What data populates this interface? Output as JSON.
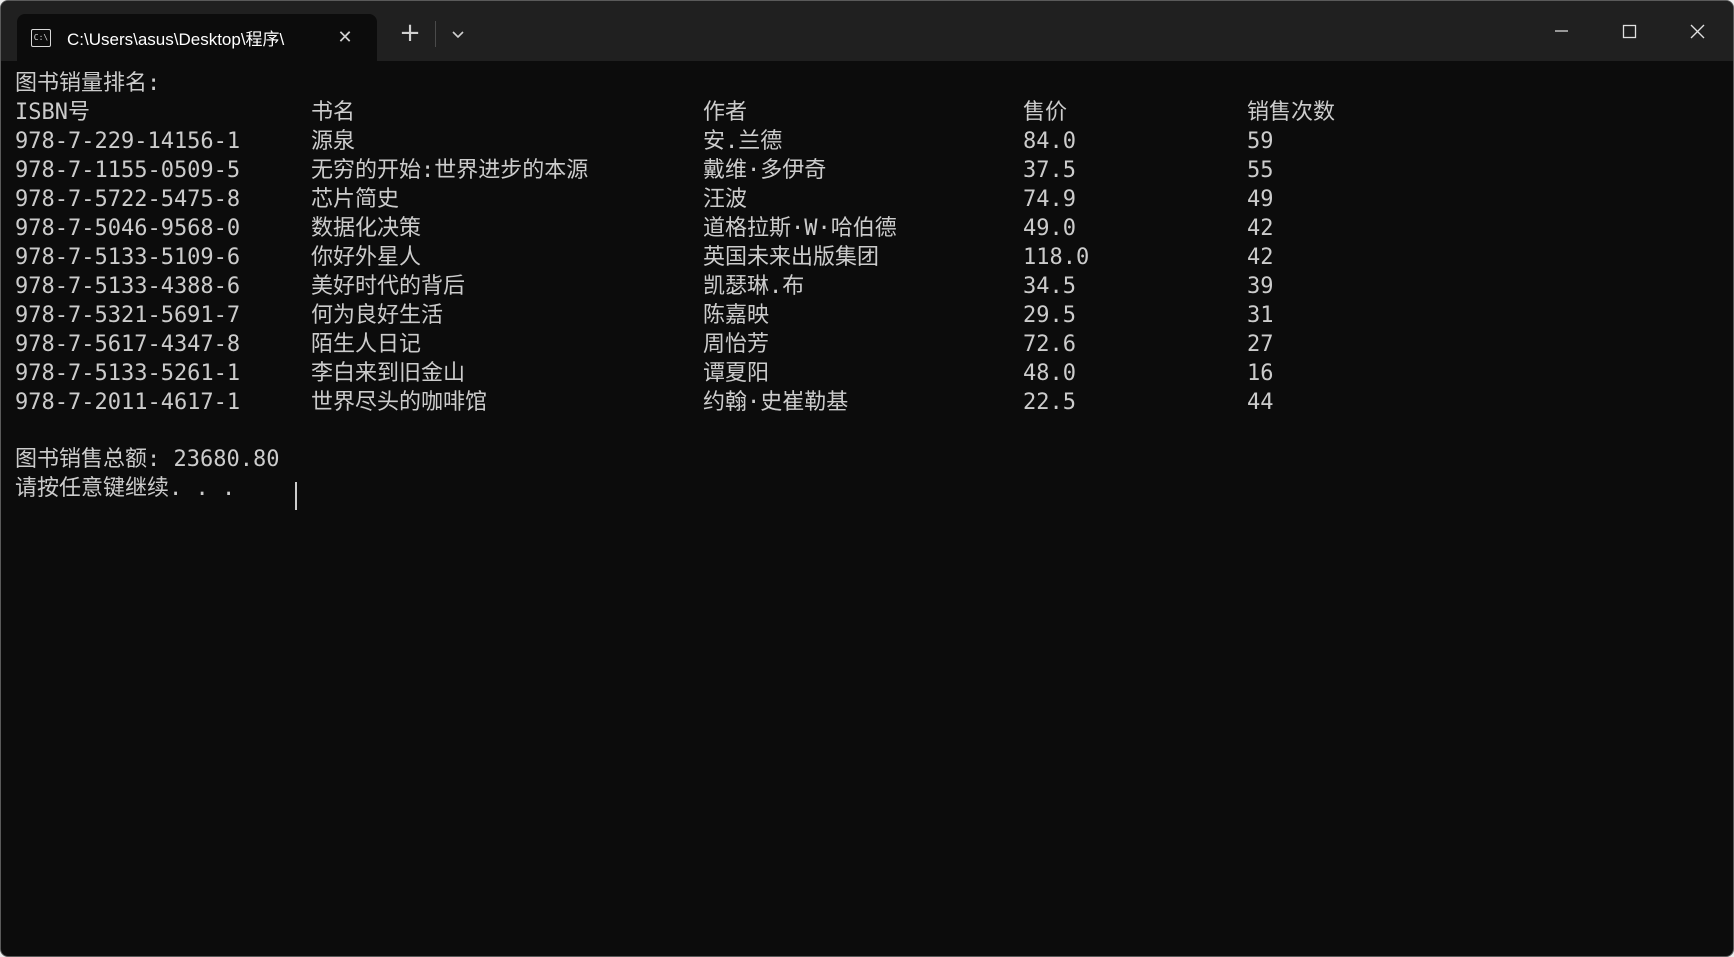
{
  "window": {
    "tab_title": "C:\\Users\\asus\\Desktop\\程序\\",
    "tab_icon": "console-icon",
    "controls": [
      "minimize-icon",
      "maximize-icon",
      "close-icon"
    ]
  },
  "console": {
    "heading": "图书销量排名:",
    "columns": [
      "ISBN号",
      "书名",
      "作者",
      "售价",
      "销售次数"
    ],
    "rows": [
      [
        "978-7-229-14156-1",
        "源泉",
        "安.兰德",
        "84.0",
        "59"
      ],
      [
        "978-7-1155-0509-5",
        "无穷的开始:世界进步的本源",
        "戴维·多伊奇",
        "37.5",
        "55"
      ],
      [
        "978-7-5722-5475-8",
        "芯片简史",
        "汪波",
        "74.9",
        "49"
      ],
      [
        "978-7-5046-9568-0",
        "数据化决策",
        "道格拉斯·W·哈伯德",
        "49.0",
        "42"
      ],
      [
        "978-7-5133-5109-6",
        "你好外星人",
        "英国未来出版集团",
        "118.0",
        "42"
      ],
      [
        "978-7-5133-4388-6",
        "美好时代的背后",
        "凯瑟琳.布",
        "34.5",
        "39"
      ],
      [
        "978-7-5321-5691-7",
        "何为良好生活",
        "陈嘉映",
        "29.5",
        "31"
      ],
      [
        "978-7-5617-4347-8",
        "陌生人日记",
        "周怡芳",
        "72.6",
        "27"
      ],
      [
        "978-7-5133-5261-1",
        "李白来到旧金山",
        "谭夏阳",
        "48.0",
        "16"
      ],
      [
        "978-7-2011-4617-1",
        "世界尽头的咖啡馆",
        "约翰·史崔勒基",
        "22.5",
        "44"
      ]
    ],
    "total_line": "图书销售总额: 23680.80",
    "prompt_line": "请按任意键继续. . ."
  }
}
